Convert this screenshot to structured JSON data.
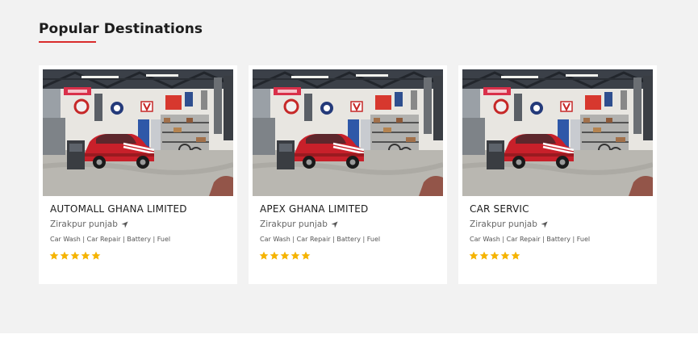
{
  "section": {
    "heading": "Popular Destinations",
    "accent_color": "#d92c2c"
  },
  "cards": [
    {
      "title": "AUTOMALL GHANA LIMITED",
      "location": "Zirakpur punjab",
      "services": "Car Wash | Car Repair | Battery | Fuel",
      "rating": 5,
      "image": "garage-with-red-classic-car"
    },
    {
      "title": "APEX GHANA LIMITED",
      "location": "Zirakpur punjab",
      "services": "Car Wash | Car Repair | Battery | Fuel",
      "rating": 5,
      "image": "garage-with-red-classic-car"
    },
    {
      "title": "CAR SERVIC",
      "location": "Zirakpur punjab",
      "services": "Car Wash | Car Repair | Battery | Fuel",
      "rating": 5,
      "image": "garage-with-red-classic-car"
    }
  ],
  "icons": {
    "location": "navigation-arrow-icon",
    "rating": "star-icon"
  },
  "colors": {
    "star": "#f5b301",
    "section_background": "#f2f2f2"
  }
}
